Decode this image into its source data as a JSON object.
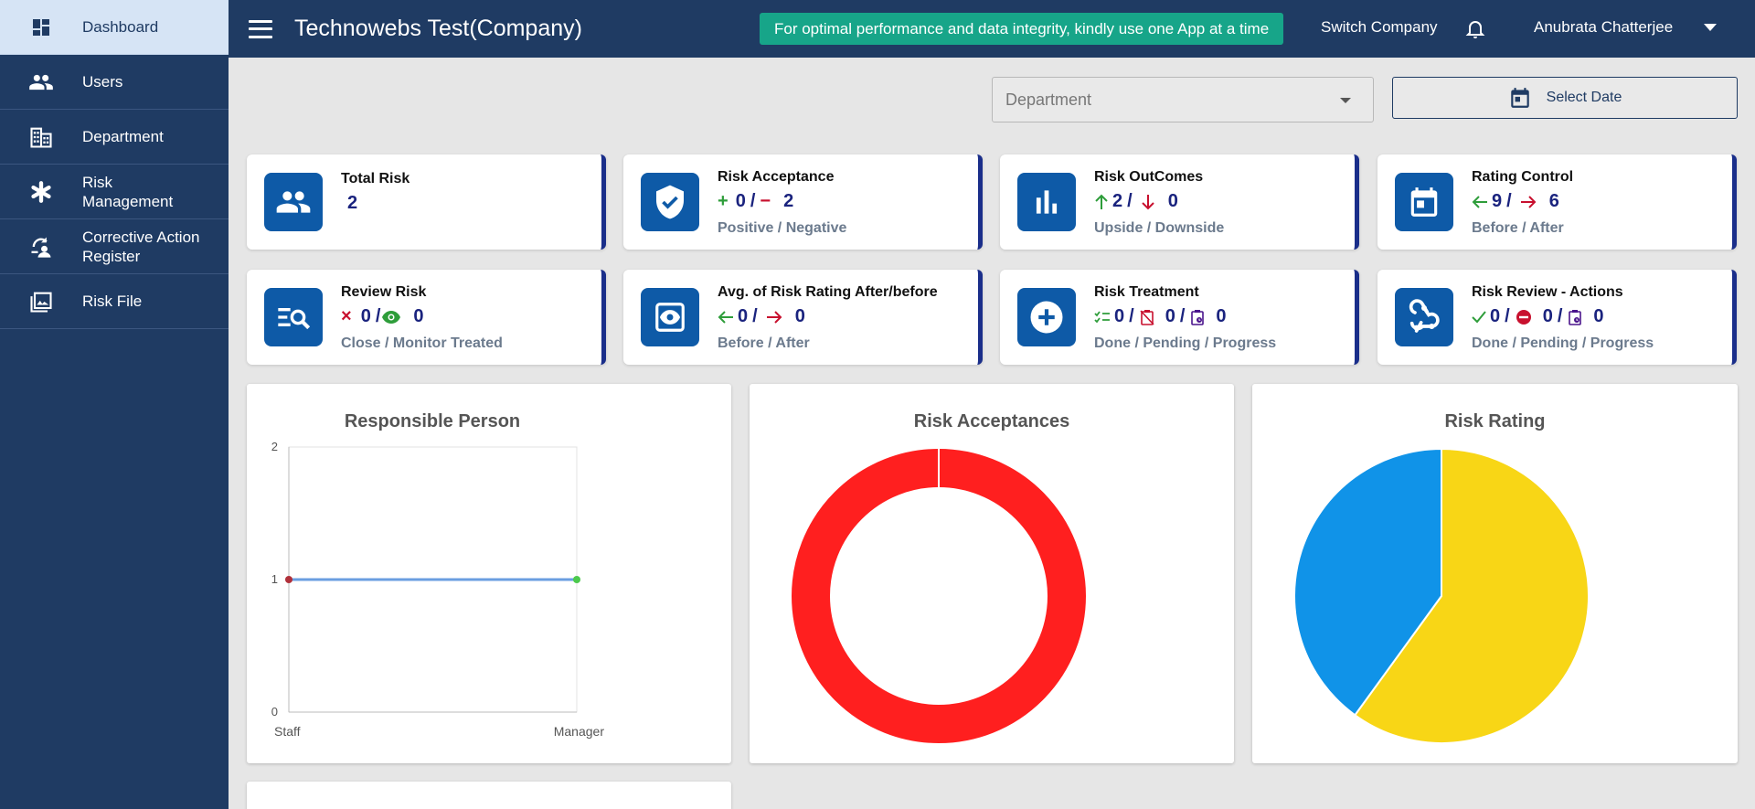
{
  "sidebar": {
    "items": [
      {
        "label": "Dashboard",
        "icon": "dashboard-icon"
      },
      {
        "label": "Users",
        "icon": "users-icon"
      },
      {
        "label": "Department",
        "icon": "department-icon"
      },
      {
        "label": "Risk Management",
        "icon": "asterisk-icon"
      },
      {
        "label": "Corrective Action Register",
        "icon": "corrective-action-icon"
      },
      {
        "label": "Risk File",
        "icon": "risk-file-icon"
      }
    ]
  },
  "header": {
    "title": "Technowebs Test(Company)",
    "notice": "For optimal performance and data integrity, kindly use one App at a time",
    "switch_company": "Switch Company",
    "username": "Anubrata Chatterjee"
  },
  "filters": {
    "department_placeholder": "Department",
    "date_label": "Select Date"
  },
  "cards": {
    "total_risk": {
      "title": "Total Risk",
      "value": "2"
    },
    "risk_acceptance": {
      "title": "Risk Acceptance",
      "v1": "0",
      "v2": "2",
      "sub": "Positive / Negative"
    },
    "risk_outcomes": {
      "title": "Risk OutComes",
      "v1": "2",
      "v2": "0",
      "sub": "Upside / Downside"
    },
    "rating_control": {
      "title": "Rating Control",
      "v1": "9",
      "v2": "6",
      "sub": "Before / After"
    },
    "review_risk": {
      "title": "Review Risk",
      "v1": "0",
      "v2": "0",
      "sub": "Close / Monitor Treated"
    },
    "avg_rating": {
      "title": "Avg. of Risk Rating After/before",
      "v1": "0",
      "v2": "0",
      "sub": "Before / After"
    },
    "risk_treatment": {
      "title": "Risk Treatment",
      "v1": "0",
      "v2": "0",
      "v3": "0",
      "sub": "Done / Pending / Progress"
    },
    "risk_review_actions": {
      "title": "Risk Review - Actions",
      "v1": "0",
      "v2": "0",
      "v3": "0",
      "sub": "Done / Pending / Progress"
    }
  },
  "colors": {
    "sidebar": "#1f3b63",
    "accent_blue": "#0e5aa7",
    "notice_green": "#17a589",
    "donut_red": "#ff1f1f",
    "pie_blue": "#1093e8",
    "pie_yellow": "#f8d616"
  },
  "chart_data": [
    {
      "type": "line",
      "title": "Responsible Person",
      "categories": [
        "Staff",
        "Manager"
      ],
      "series": [
        {
          "values": [
            1,
            1
          ]
        }
      ],
      "ylim": [
        0,
        2
      ],
      "yticks": [
        "0",
        "1",
        "2"
      ],
      "grid": true
    },
    {
      "type": "pie",
      "title": "Risk Acceptances",
      "donut": true,
      "values": [
        2
      ],
      "colors": [
        "#ff1f1f"
      ]
    },
    {
      "type": "pie",
      "title": "Risk Rating",
      "values": [
        9,
        6
      ],
      "colors": [
        "#f8d616",
        "#1093e8"
      ]
    }
  ]
}
